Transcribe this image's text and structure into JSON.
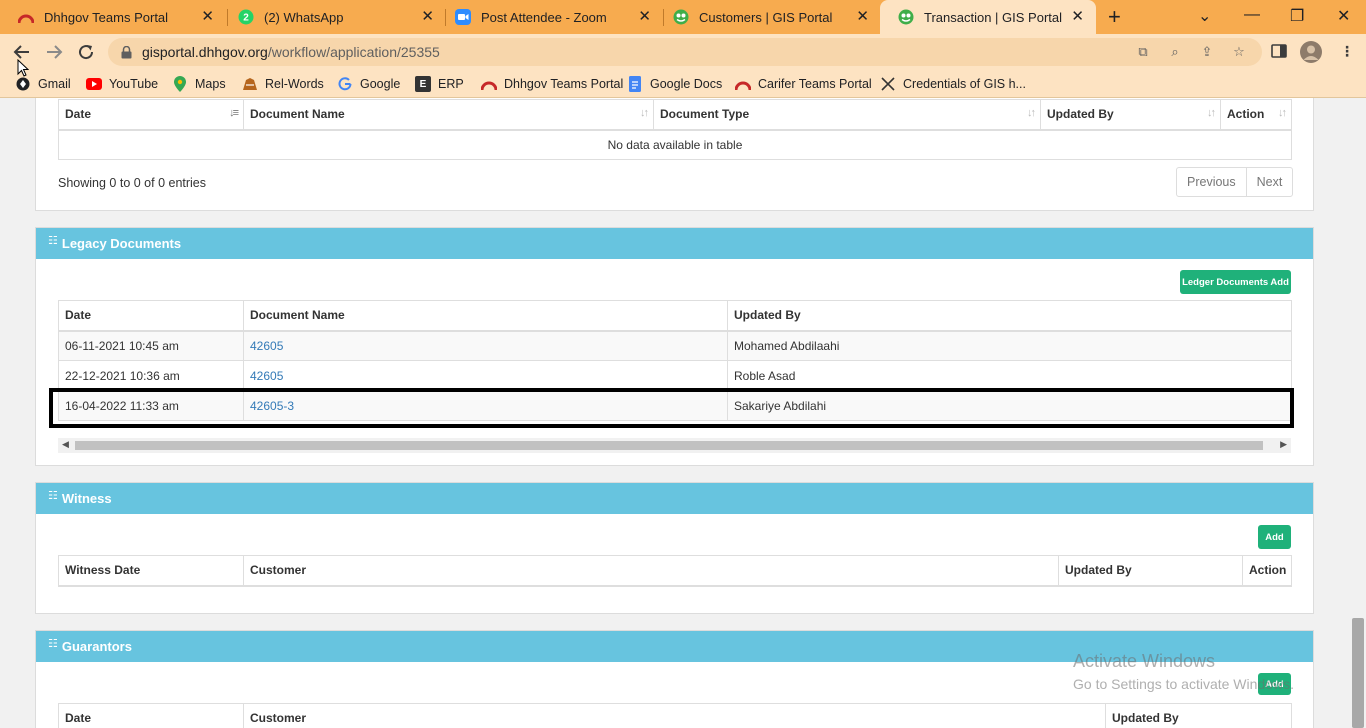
{
  "browser": {
    "tabs": [
      {
        "title": "Dhhgov Teams Portal",
        "icon": "dhhgov-icon"
      },
      {
        "title": "(2) WhatsApp",
        "icon": "whatsapp-icon",
        "badge": "2"
      },
      {
        "title": "Post Attendee - Zoom",
        "icon": "zoom-icon"
      },
      {
        "title": "Customers | GIS Portal",
        "icon": "gis-icon"
      },
      {
        "title": "Transaction | GIS Portal",
        "icon": "gis-icon",
        "active": true
      }
    ],
    "url_host": "gisportal.dhhgov.org",
    "url_path": "/workflow/application/25355",
    "bookmarks": [
      {
        "label": "Gmail",
        "icon": "gmail-icon"
      },
      {
        "label": "YouTube",
        "icon": "youtube-icon"
      },
      {
        "label": "Maps",
        "icon": "maps-icon"
      },
      {
        "label": "Rel-Words",
        "icon": "relwords-icon"
      },
      {
        "label": "Google",
        "icon": "google-icon"
      },
      {
        "label": "ERP",
        "icon": "erp-icon",
        "glyph": "E"
      },
      {
        "label": "Dhhgov Teams Portal",
        "icon": "dhhgov-icon"
      },
      {
        "label": "Google Docs",
        "icon": "docs-icon"
      },
      {
        "label": "Carifer Teams Portal",
        "icon": "carifer-icon"
      },
      {
        "label": "Credentials of GIS h...",
        "icon": "credentials-icon"
      }
    ]
  },
  "documents_table": {
    "columns": [
      "Date",
      "Document Name",
      "Document Type",
      "Updated By",
      "Action"
    ],
    "empty_message": "No data available in table",
    "info": "Showing 0 to 0 of 0 entries",
    "prev_label": "Previous",
    "next_label": "Next"
  },
  "legacy": {
    "title": "Legacy Documents",
    "add_label": "Ledger Documents Add",
    "columns": [
      "Date",
      "Document Name",
      "Updated By"
    ],
    "rows": [
      {
        "date": "06-11-2021 10:45 am",
        "doc": "42605",
        "by": "Mohamed Abdilaahi"
      },
      {
        "date": "22-12-2021 10:36 am",
        "doc": "42605",
        "by": "Roble Asad"
      },
      {
        "date": "16-04-2022 11:33 am",
        "doc": "42605-3",
        "by": "Sakariye Abdilahi"
      }
    ]
  },
  "witness": {
    "title": "Witness",
    "add_label": "Add",
    "columns": [
      "Witness Date",
      "Customer",
      "Updated By",
      "Action"
    ]
  },
  "guarantors": {
    "title": "Guarantors",
    "add_label": "Add",
    "columns": [
      "Date",
      "Customer",
      "Updated By"
    ]
  },
  "watermark": {
    "line1": "Activate Windows",
    "line2": "Go to Settings to activate Windows."
  }
}
